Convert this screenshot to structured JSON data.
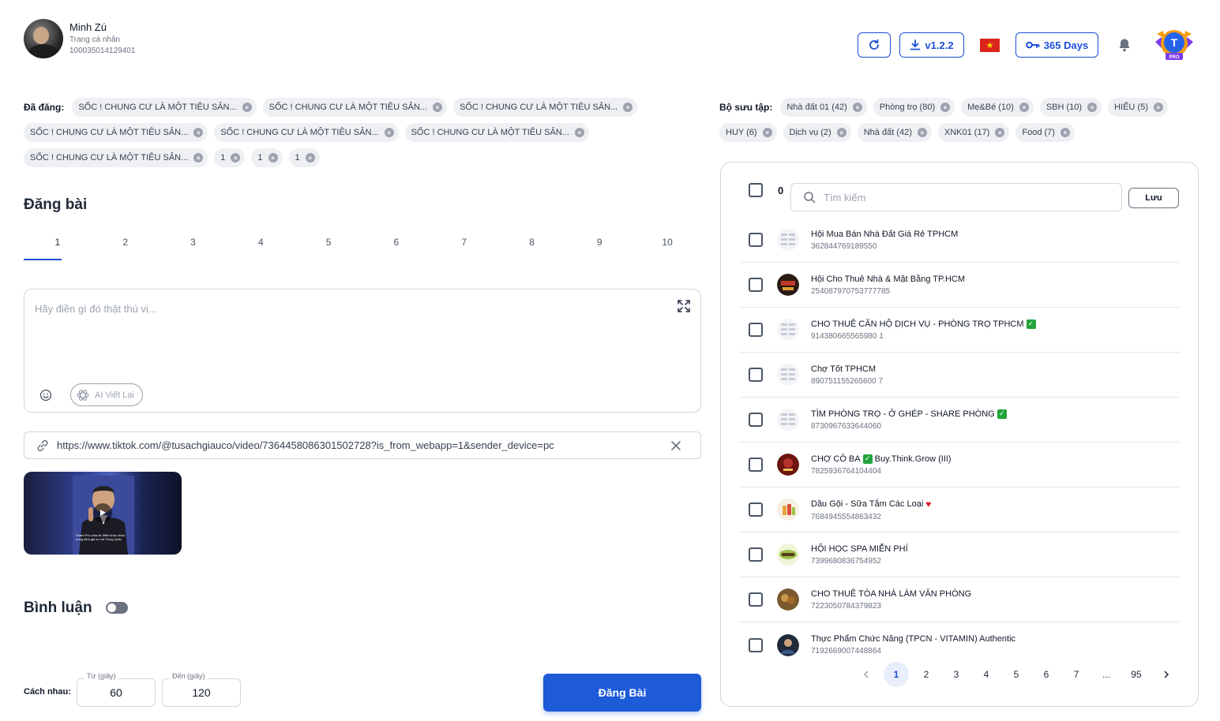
{
  "profile": {
    "name": "Minh Zú",
    "subtitle": "Trang cá nhân",
    "id": "100035014129401"
  },
  "header": {
    "version_label": "v1.2.2",
    "days_label": "365 Days",
    "pro_initial": "T",
    "pro_label": "PRO"
  },
  "posted": {
    "label": "Đã đăng:",
    "rows": [
      [
        "SỐC ! CHUNG CƯ LÀ MỘT TIÊU SẢN...",
        "SỐC ! CHUNG CƯ LÀ MỘT TIÊU SẢN...",
        "SỐC ! CHUNG CƯ LÀ MỘT TIÊU SẢN..."
      ],
      [
        "SỐC ! CHUNG CƯ LÀ MỘT TIÊU SẢN...",
        "SỐC ! CHUNG CƯ LÀ MỘT TIÊU SẢN...",
        "SỐC ! CHUNG CƯ LÀ MỘT TIÊU SẢN..."
      ],
      [
        "SỐC ! CHUNG CƯ LÀ MỘT TIÊU SẢN...",
        "1",
        "1",
        "1"
      ]
    ]
  },
  "collection": {
    "label": "Bộ sưu tập:",
    "rows": [
      [
        "Nhà đất 01 (42)",
        "Phòng trọ (80)",
        "Mẹ&Bé (10)",
        "SBH (10)",
        "HIẾU (5)"
      ],
      [
        "HUY (6)",
        "Dịch vụ (2)",
        "Nhà đất (42)",
        "XNK01 (17)",
        "Food (7)"
      ]
    ]
  },
  "post": {
    "title": "Đăng bài",
    "tabs": [
      "1",
      "2",
      "3",
      "4",
      "5",
      "6",
      "7",
      "8",
      "9",
      "10"
    ],
    "editor_placeholder": "Hãy điền gì đó thật thú vị...",
    "ai_button": "AI Viết Lại",
    "link": "https://www.tiktok.com/@tusachgiauco/video/7364458086301502728?is_from_webapp=1&sender_device=pc",
    "video_caption": "Shark Phú chia sẻ điểm khác nhau trong định giá so với Trung Quốc",
    "comment_title": "Bình luận",
    "spacing_label": "Cách nhau:",
    "from_label": "Từ (giây)",
    "from_value": "60",
    "to_label": "Đến (giây)",
    "to_value": "120",
    "submit": "Đăng Bài"
  },
  "groups": {
    "selected_count": "0",
    "search_placeholder": "Tìm kiếm",
    "save_label": "Lưu",
    "items": [
      {
        "name": "Hội Mua Bán Nhà Đất Giá Rẻ TPHCM",
        "id": "362844769189550",
        "suffix": ""
      },
      {
        "name": "Hội Cho Thuê Nhà & Mặt Bằng TP.HCM",
        "id": "254087970753777785",
        "suffix": ""
      },
      {
        "name": "CHO THUÊ CĂN HỘ DỊCH VỤ - PHÒNG TRỌ TPHCM",
        "id": "914380665565980 1",
        "suffix": "check"
      },
      {
        "name": "Chợ Tốt TPHCM",
        "id": "890751155265600 7",
        "suffix": ""
      },
      {
        "name": "TÌM PHÒNG TRỌ - Ở GHÉP - SHARE PHÒNG",
        "id": "8730967633644060",
        "suffix": "check"
      },
      {
        "name": "CHỢ CÔ BA",
        "name2": "Buy.Think.Grow (III)",
        "id": "7825936764104404",
        "suffix": "check-mid"
      },
      {
        "name": "Dầu Gội - Sữa Tắm Các Loại",
        "id": "7684945554863432",
        "suffix": "heart"
      },
      {
        "name": "HỘI HỌC SPA MIỄN PHÍ",
        "id": "7399680836754952",
        "suffix": ""
      },
      {
        "name": "CHO THUÊ TÒA NHÀ LÀM VĂN PHÒNG",
        "id": "7223050784379823",
        "suffix": ""
      },
      {
        "name": "Thực Phẩm Chức Năng (TPCN - VITAMIN) Authentic",
        "id": "7192669007448864",
        "suffix": ""
      }
    ],
    "pages": [
      "1",
      "2",
      "3",
      "4",
      "5",
      "6",
      "7",
      "...",
      "95"
    ]
  },
  "colors": {
    "accent": "#1d4ed8",
    "primary_button": "#1d5bd8",
    "flag_red": "#da251d",
    "flag_star": "#ffde00"
  }
}
